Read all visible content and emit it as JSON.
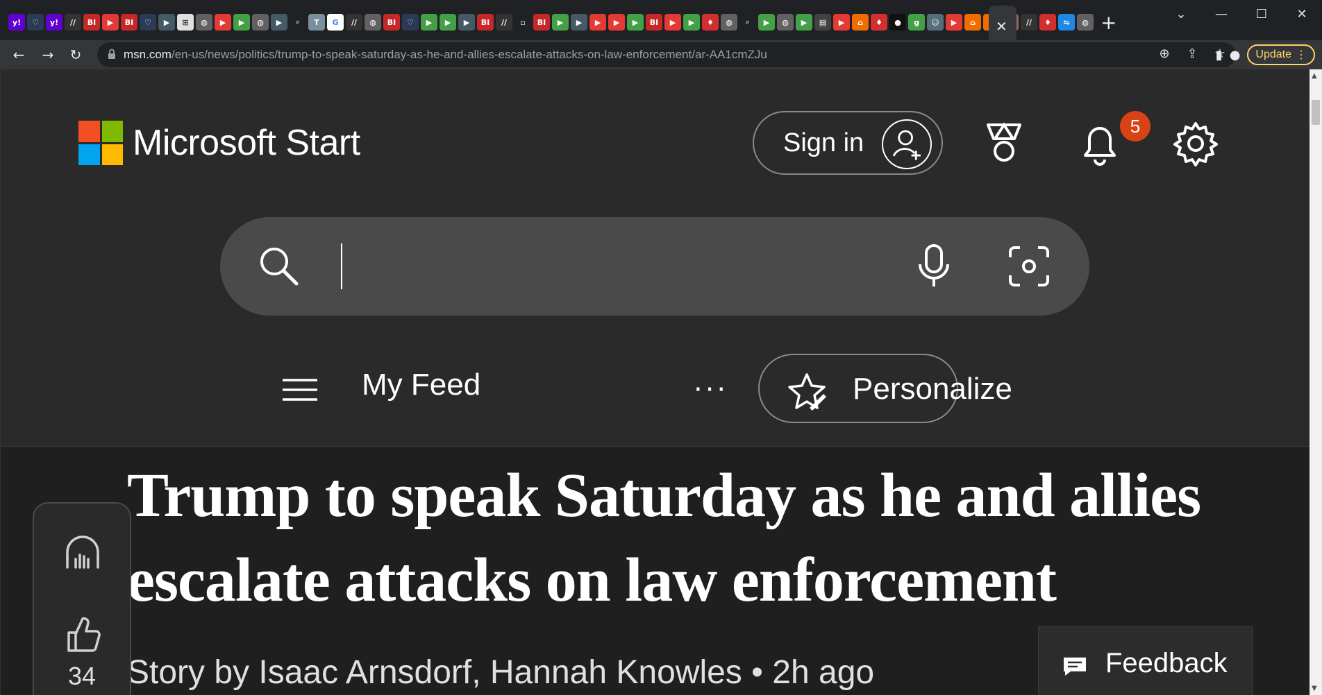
{
  "browser": {
    "active_tab_close": "✕",
    "new_tab": "+",
    "url_host": "msn.com",
    "url_path": "/en-us/news/politics/trump-to-speak-saturday-as-he-and-allies-escalate-attacks-on-law-enforcement/ar-AA1cmZJu",
    "update_label": "Update",
    "icons": [
      "back-arrow-icon",
      "forward-arrow-icon",
      "reload-icon",
      "lock-icon",
      "zoom-icon",
      "share-icon",
      "star-icon",
      "sidepanel-icon",
      "profile-icon",
      "kebab-menu-icon"
    ]
  },
  "header": {
    "brand": "Microsoft Start",
    "signin_label": "Sign in",
    "notification_count": "5"
  },
  "search": {
    "value": ""
  },
  "feed_bar": {
    "menu": "My Feed",
    "more": "···",
    "personalize": "Personalize"
  },
  "article": {
    "title": "Trump to speak Saturday as he and allies escalate attacks on law enforcement",
    "byline": "Story by Isaac Arnsdorf, Hannah Knowles • 2h ago"
  },
  "rail": {
    "like_count": "34"
  },
  "feedback": {
    "label": "Feedback"
  },
  "colors": {
    "page_bg": "#1f1f1f",
    "header_bg": "#2a2a2a",
    "search_bg": "#4a4a4a",
    "badge": "#d84315",
    "update": "#fdd663"
  }
}
